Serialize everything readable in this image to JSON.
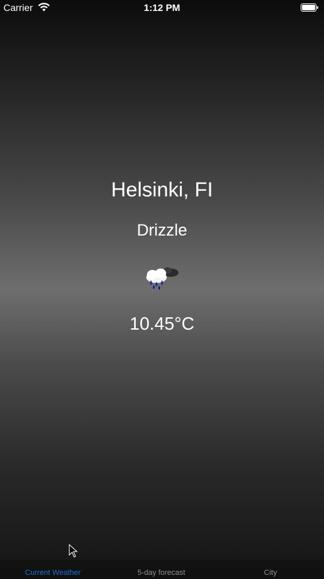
{
  "status_bar": {
    "carrier": "Carrier",
    "time": "1:12 PM",
    "wifi_icon": "wifi-icon",
    "battery_icon": "battery-icon"
  },
  "weather": {
    "city": "Helsinki, FI",
    "condition": "Drizzle",
    "icon": "drizzle-cloud-icon",
    "temperature": "10.45°C"
  },
  "tab_bar": {
    "tabs": [
      {
        "label": "Current Weather",
        "active": true
      },
      {
        "label": "5-day forecast",
        "active": false
      },
      {
        "label": "City",
        "active": false
      }
    ]
  },
  "colors": {
    "active_tab": "#1f6fd6",
    "inactive_tab": "#8e8e93",
    "text": "#ffffff"
  }
}
